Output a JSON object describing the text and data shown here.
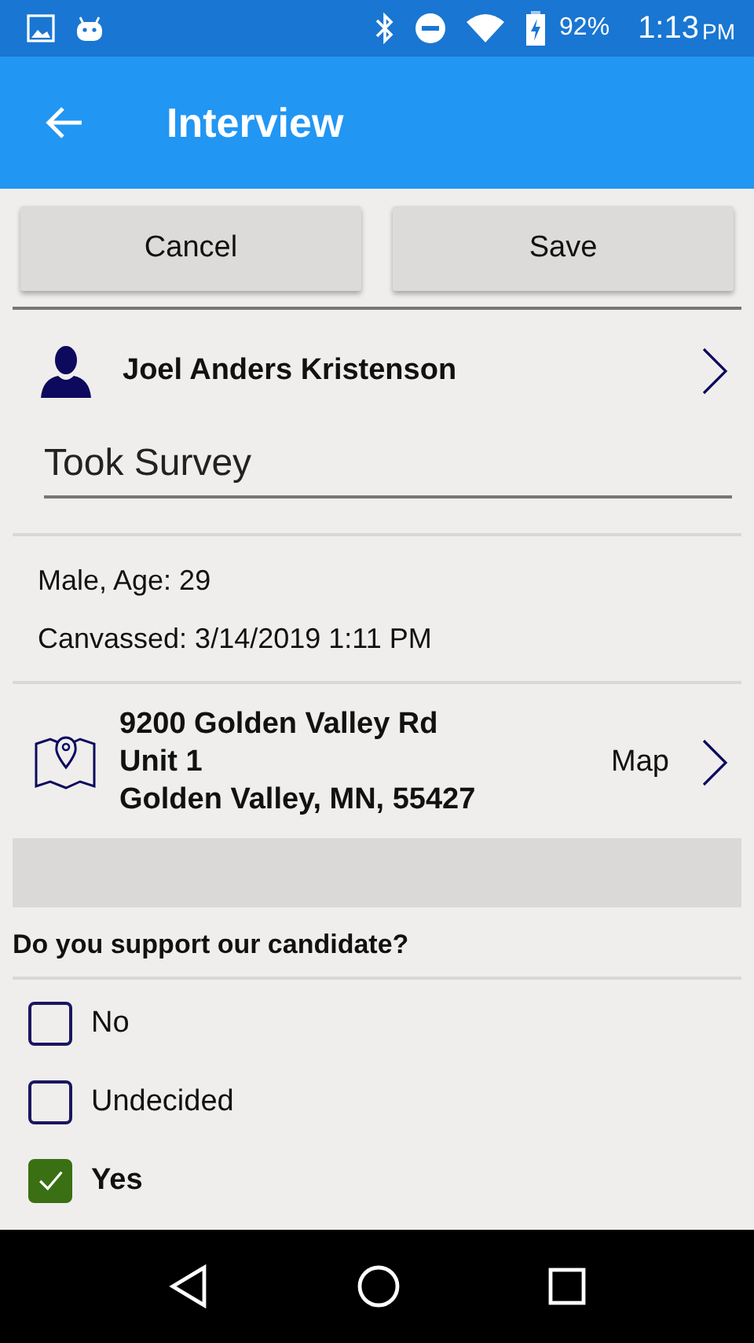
{
  "status_bar": {
    "battery": "92%",
    "time": "1:13",
    "ampm": "PM"
  },
  "app_bar": {
    "title": "Interview"
  },
  "buttons": [
    {
      "label": "Cancel"
    },
    {
      "label": "Save"
    }
  ],
  "person": {
    "name": "Joel Anders Kristenson"
  },
  "result_field": {
    "value": "Took Survey"
  },
  "details": [
    "Male, Age: 29",
    "Canvassed: 3/14/2019 1:11 PM"
  ],
  "address": {
    "lines": [
      "9200 Golden Valley Rd",
      "Unit 1",
      "Golden Valley, MN, 55427"
    ],
    "link": "Map"
  },
  "question": {
    "text": "Do you support our candidate?",
    "options": [
      {
        "label": "No",
        "checked": false
      },
      {
        "label": "Undecided",
        "checked": false
      },
      {
        "label": "Yes",
        "checked": true
      }
    ]
  }
}
